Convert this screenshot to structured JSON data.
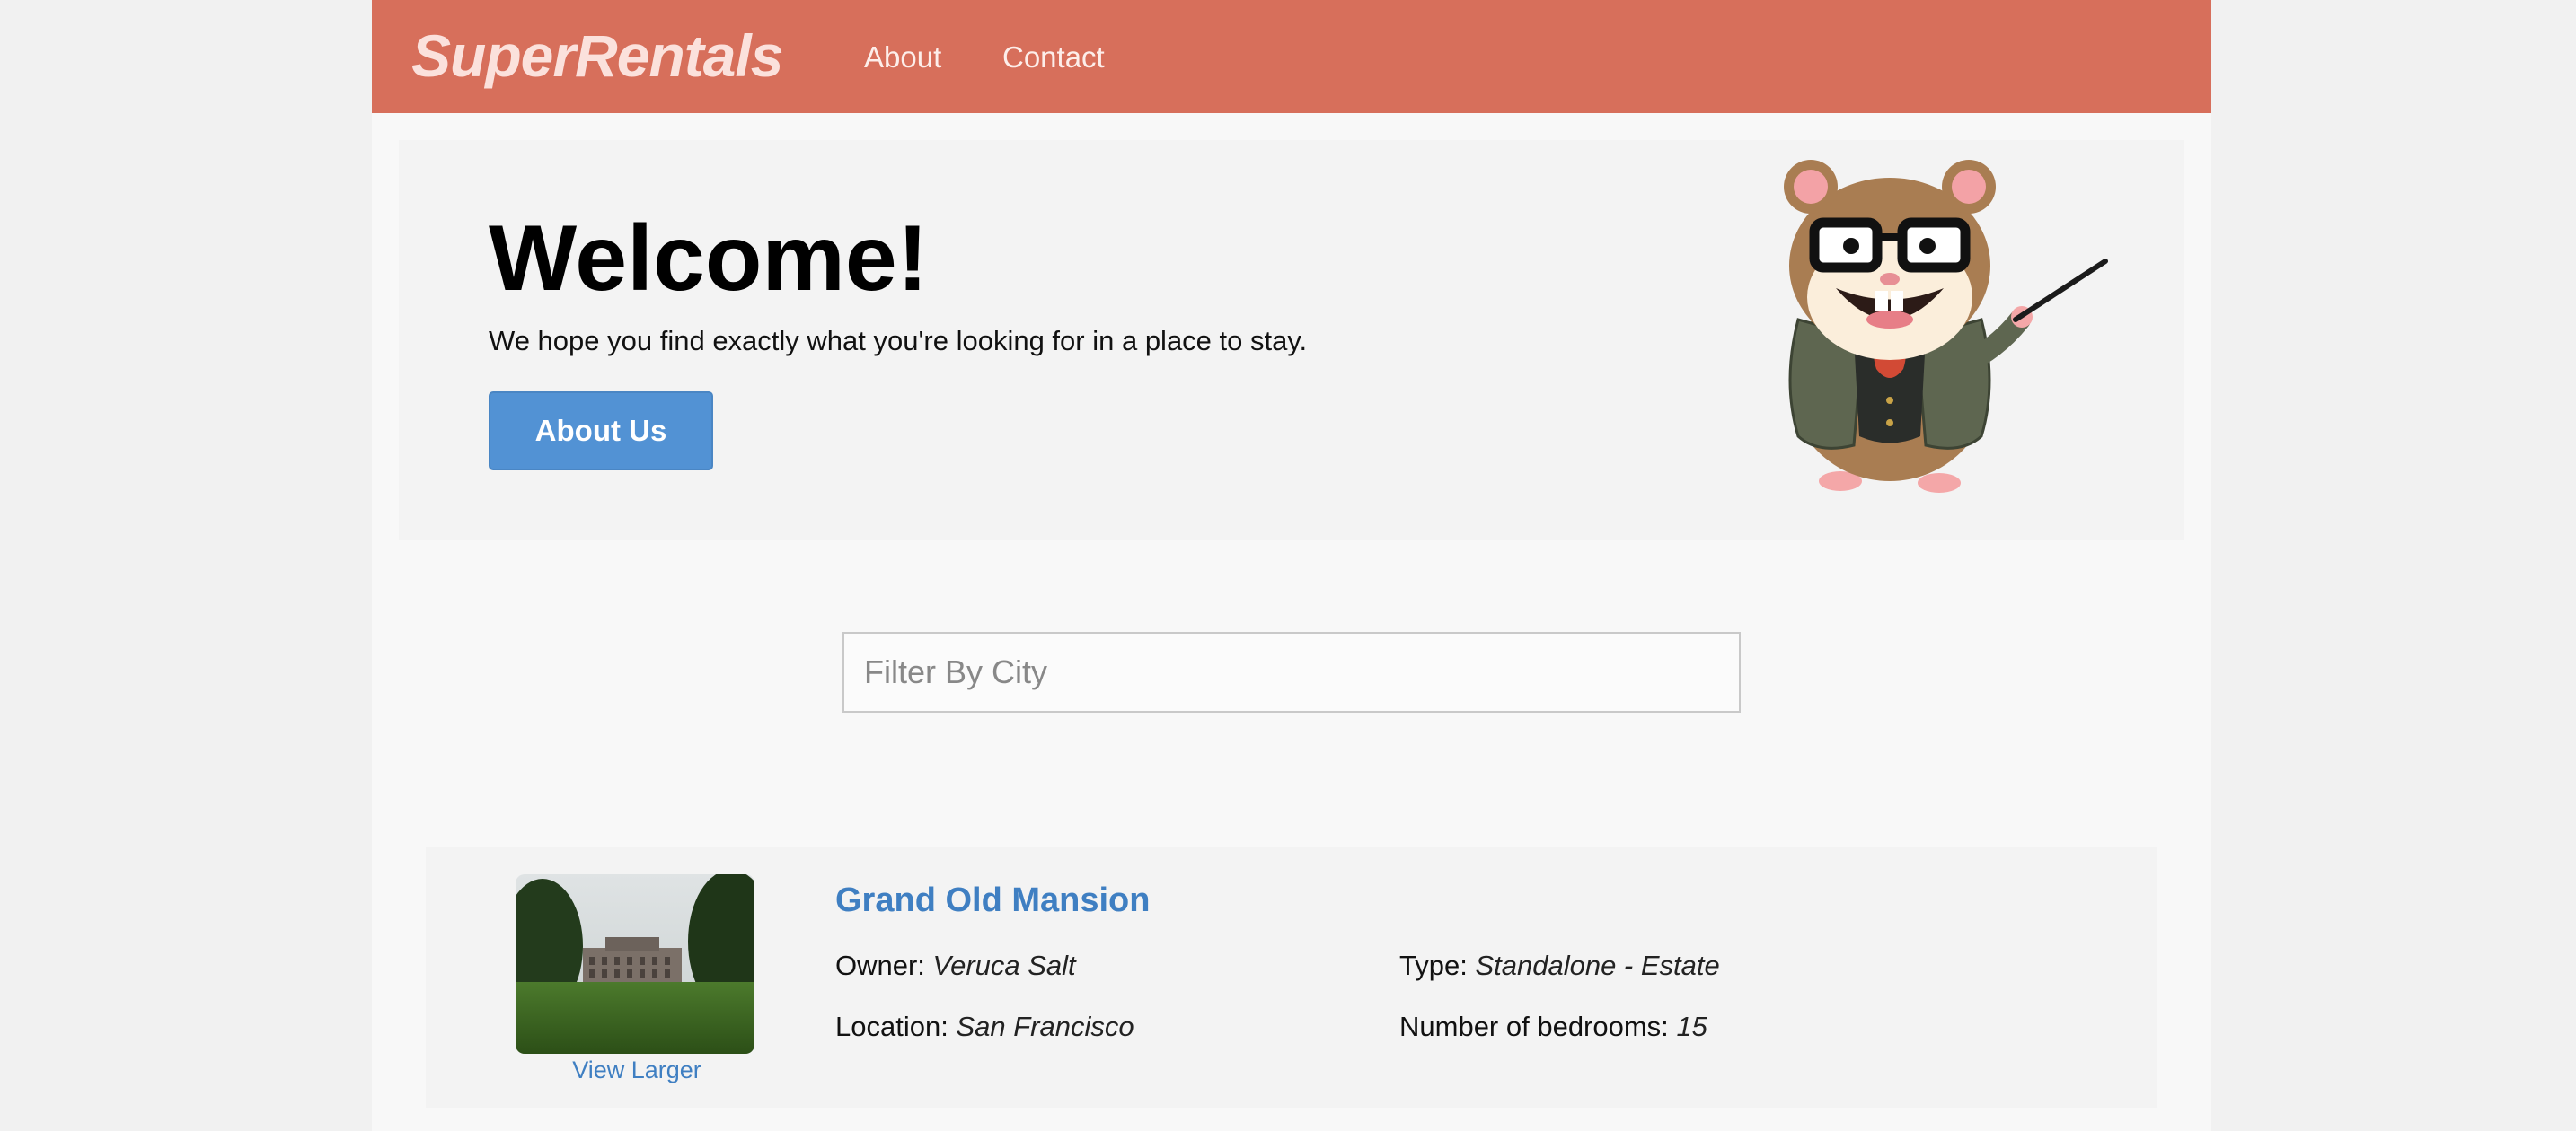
{
  "header": {
    "brand": "SuperRentals",
    "nav": {
      "about": "About",
      "contact": "Contact"
    }
  },
  "jumbotron": {
    "title": "Welcome!",
    "text": "We hope you find exactly what you're looking for in a place to stay.",
    "button_label": "About Us",
    "mascot_icon": "tomster-hamster-pointer"
  },
  "filter": {
    "placeholder": "Filter By City",
    "value": ""
  },
  "listings": [
    {
      "title": "Grand Old Mansion",
      "image_icon": "mansion-photo",
      "view_larger": "View Larger",
      "owner_label": "Owner:",
      "owner": "Veruca Salt",
      "type_label": "Type:",
      "type": "Standalone - Estate",
      "location_label": "Location:",
      "location": "San Francisco",
      "bedrooms_label": "Number of bedrooms:",
      "bedrooms": "15"
    }
  ],
  "colors": {
    "header_bg": "#d76f5b",
    "button_bg": "#5292d4",
    "link": "#3f7fc2",
    "page_bg": "#f8f8f8"
  }
}
